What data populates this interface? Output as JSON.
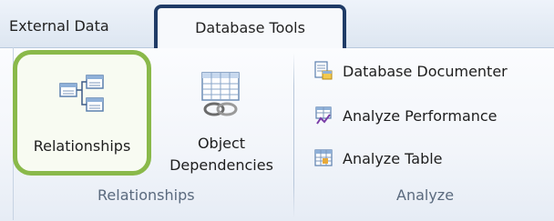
{
  "tabs": {
    "external_data": "External Data",
    "database_tools": "Database Tools"
  },
  "groups": {
    "relationships": {
      "label": "Relationships",
      "relationships_button": "Relationships",
      "object_dependencies_line1": "Object",
      "object_dependencies_line2": "Dependencies"
    },
    "analyze": {
      "label": "Analyze",
      "database_documenter": "Database Documenter",
      "analyze_performance": "Analyze Performance",
      "analyze_table": "Analyze Table"
    }
  },
  "highlights": {
    "tab_outline_color": "#1f3b66",
    "button_outline_color": "#8ab94a"
  }
}
